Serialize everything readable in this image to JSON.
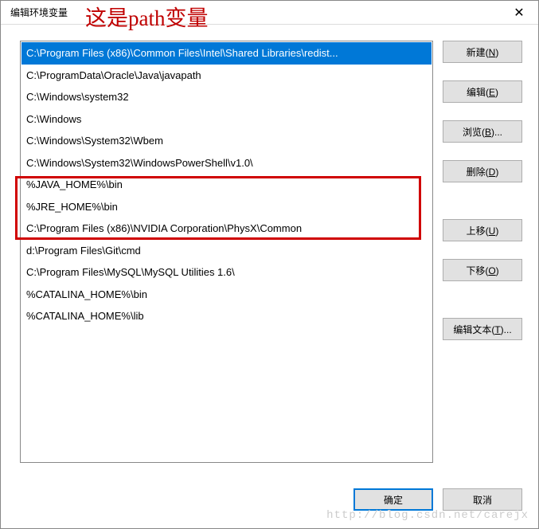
{
  "titlebar": {
    "title": "编辑环境变量",
    "close": "✕"
  },
  "annotation": "这是path变量",
  "list": {
    "items": [
      {
        "text": "C:\\Program Files (x86)\\Common Files\\Intel\\Shared Libraries\\redist...",
        "selected": true
      },
      {
        "text": "C:\\ProgramData\\Oracle\\Java\\javapath",
        "selected": false
      },
      {
        "text": "C:\\Windows\\system32",
        "selected": false
      },
      {
        "text": "C:\\Windows",
        "selected": false
      },
      {
        "text": "C:\\Windows\\System32\\Wbem",
        "selected": false
      },
      {
        "text": "C:\\Windows\\System32\\WindowsPowerShell\\v1.0\\",
        "selected": false
      },
      {
        "text": "%JAVA_HOME%\\bin",
        "selected": false
      },
      {
        "text": "%JRE_HOME%\\bin",
        "selected": false
      },
      {
        "text": "C:\\Program Files (x86)\\NVIDIA Corporation\\PhysX\\Common",
        "selected": false
      },
      {
        "text": "d:\\Program Files\\Git\\cmd",
        "selected": false
      },
      {
        "text": "C:\\Program Files\\MySQL\\MySQL Utilities 1.6\\",
        "selected": false
      },
      {
        "text": "%CATALINA_HOME%\\bin",
        "selected": false
      },
      {
        "text": "%CATALINA_HOME%\\lib",
        "selected": false
      }
    ]
  },
  "buttons": {
    "new": "新建(N)",
    "edit": "编辑(E)",
    "browse": "浏览(B)...",
    "delete": "删除(D)",
    "moveup": "上移(U)",
    "movedown": "下移(O)",
    "edittext": "编辑文本(T)...",
    "ok": "确定",
    "cancel": "取消"
  },
  "watermark": "http://blog.csdn.net/carejx"
}
